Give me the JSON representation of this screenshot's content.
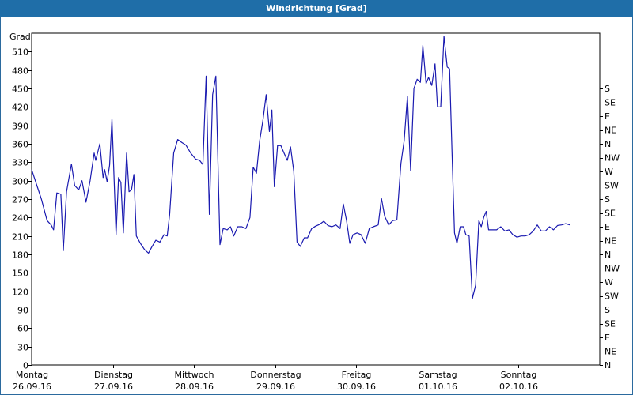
{
  "window": {
    "title": "Windrichtung [Grad]"
  },
  "chart_data": {
    "type": "line",
    "title": "Windrichtung [Grad]",
    "ylabel": "Grad",
    "xlabel": "",
    "ylim": [
      0,
      540
    ],
    "yticks": [
      0,
      30,
      60,
      90,
      120,
      150,
      180,
      210,
      240,
      270,
      300,
      330,
      360,
      390,
      420,
      450,
      480,
      510
    ],
    "right_axis_labels": [
      "N",
      "NE",
      "E",
      "SE",
      "S",
      "SW",
      "W",
      "NW",
      "N",
      "NE",
      "E",
      "SE",
      "S",
      "SW",
      "W",
      "NW",
      "N",
      "NE",
      "E",
      "SE",
      "S"
    ],
    "right_axis_step": 22.5,
    "x_range": [
      0,
      7
    ],
    "x_categories": [
      {
        "day": "Montag",
        "date": "26.09.16"
      },
      {
        "day": "Dienstag",
        "date": "27.09.16"
      },
      {
        "day": "Mittwoch",
        "date": "28.09.16"
      },
      {
        "day": "Donnerstag",
        "date": "29.09.16"
      },
      {
        "day": "Freitag",
        "date": "30.09.16"
      },
      {
        "day": "Samstag",
        "date": "01.10.16"
      },
      {
        "day": "Sonntag",
        "date": "02.10.16"
      }
    ],
    "grid": true,
    "series": [
      {
        "color": "#1a1ab0",
        "points": [
          [
            0.0,
            318
          ],
          [
            0.05,
            298
          ],
          [
            0.12,
            270
          ],
          [
            0.19,
            235
          ],
          [
            0.24,
            228
          ],
          [
            0.27,
            220
          ],
          [
            0.31,
            280
          ],
          [
            0.36,
            278
          ],
          [
            0.39,
            186
          ],
          [
            0.43,
            282
          ],
          [
            0.49,
            327
          ],
          [
            0.53,
            292
          ],
          [
            0.58,
            285
          ],
          [
            0.62,
            300
          ],
          [
            0.67,
            265
          ],
          [
            0.72,
            300
          ],
          [
            0.77,
            345
          ],
          [
            0.79,
            333
          ],
          [
            0.84,
            360
          ],
          [
            0.88,
            305
          ],
          [
            0.9,
            318
          ],
          [
            0.93,
            298
          ],
          [
            0.96,
            325
          ],
          [
            0.99,
            400
          ],
          [
            1.04,
            212
          ],
          [
            1.07,
            305
          ],
          [
            1.1,
            297
          ],
          [
            1.13,
            215
          ],
          [
            1.17,
            345
          ],
          [
            1.2,
            282
          ],
          [
            1.23,
            285
          ],
          [
            1.26,
            310
          ],
          [
            1.29,
            210
          ],
          [
            1.34,
            198
          ],
          [
            1.39,
            188
          ],
          [
            1.44,
            182
          ],
          [
            1.48,
            192
          ],
          [
            1.53,
            203
          ],
          [
            1.58,
            200
          ],
          [
            1.63,
            212
          ],
          [
            1.67,
            210
          ],
          [
            1.7,
            245
          ],
          [
            1.75,
            345
          ],
          [
            1.8,
            367
          ],
          [
            1.85,
            362
          ],
          [
            1.9,
            358
          ],
          [
            1.96,
            345
          ],
          [
            2.02,
            335
          ],
          [
            2.07,
            333
          ],
          [
            2.11,
            326
          ],
          [
            2.15,
            470
          ],
          [
            2.19,
            245
          ],
          [
            2.23,
            440
          ],
          [
            2.27,
            470
          ],
          [
            2.32,
            196
          ],
          [
            2.36,
            222
          ],
          [
            2.41,
            220
          ],
          [
            2.45,
            225
          ],
          [
            2.49,
            210
          ],
          [
            2.54,
            225
          ],
          [
            2.59,
            225
          ],
          [
            2.64,
            222
          ],
          [
            2.69,
            240
          ],
          [
            2.73,
            322
          ],
          [
            2.77,
            312
          ],
          [
            2.81,
            365
          ],
          [
            2.85,
            398
          ],
          [
            2.89,
            440
          ],
          [
            2.93,
            380
          ],
          [
            2.96,
            415
          ],
          [
            2.99,
            290
          ],
          [
            3.03,
            357
          ],
          [
            3.07,
            357
          ],
          [
            3.11,
            345
          ],
          [
            3.15,
            333
          ],
          [
            3.19,
            355
          ],
          [
            3.23,
            315
          ],
          [
            3.27,
            200
          ],
          [
            3.31,
            193
          ],
          [
            3.36,
            207
          ],
          [
            3.4,
            207
          ],
          [
            3.45,
            222
          ],
          [
            3.5,
            226
          ],
          [
            3.55,
            229
          ],
          [
            3.6,
            234
          ],
          [
            3.65,
            227
          ],
          [
            3.7,
            225
          ],
          [
            3.75,
            228
          ],
          [
            3.8,
            222
          ],
          [
            3.84,
            262
          ],
          [
            3.88,
            235
          ],
          [
            3.92,
            198
          ],
          [
            3.96,
            212
          ],
          [
            4.01,
            215
          ],
          [
            4.06,
            212
          ],
          [
            4.11,
            198
          ],
          [
            4.16,
            222
          ],
          [
            4.21,
            225
          ],
          [
            4.27,
            228
          ],
          [
            4.31,
            271
          ],
          [
            4.35,
            242
          ],
          [
            4.4,
            228
          ],
          [
            4.45,
            235
          ],
          [
            4.5,
            236
          ],
          [
            4.55,
            328
          ],
          [
            4.59,
            365
          ],
          [
            4.63,
            437
          ],
          [
            4.67,
            316
          ],
          [
            4.71,
            450
          ],
          [
            4.75,
            465
          ],
          [
            4.79,
            460
          ],
          [
            4.82,
            520
          ],
          [
            4.86,
            458
          ],
          [
            4.89,
            468
          ],
          [
            4.93,
            455
          ],
          [
            4.97,
            490
          ],
          [
            5.0,
            420
          ],
          [
            5.04,
            420
          ],
          [
            5.08,
            535
          ],
          [
            5.12,
            485
          ],
          [
            5.15,
            482
          ],
          [
            5.18,
            345
          ],
          [
            5.21,
            215
          ],
          [
            5.24,
            198
          ],
          [
            5.28,
            225
          ],
          [
            5.32,
            225
          ],
          [
            5.35,
            212
          ],
          [
            5.39,
            210
          ],
          [
            5.43,
            108
          ],
          [
            5.47,
            130
          ],
          [
            5.51,
            235
          ],
          [
            5.54,
            225
          ],
          [
            5.57,
            240
          ],
          [
            5.6,
            250
          ],
          [
            5.63,
            220
          ],
          [
            5.68,
            220
          ],
          [
            5.73,
            220
          ],
          [
            5.78,
            225
          ],
          [
            5.83,
            218
          ],
          [
            5.88,
            220
          ],
          [
            5.93,
            212
          ],
          [
            5.98,
            208
          ],
          [
            6.03,
            210
          ],
          [
            6.08,
            210
          ],
          [
            6.13,
            212
          ],
          [
            6.18,
            218
          ],
          [
            6.23,
            228
          ],
          [
            6.28,
            218
          ],
          [
            6.33,
            218
          ],
          [
            6.38,
            225
          ],
          [
            6.43,
            220
          ],
          [
            6.48,
            227
          ],
          [
            6.53,
            228
          ],
          [
            6.58,
            230
          ],
          [
            6.63,
            228
          ]
        ]
      }
    ]
  }
}
